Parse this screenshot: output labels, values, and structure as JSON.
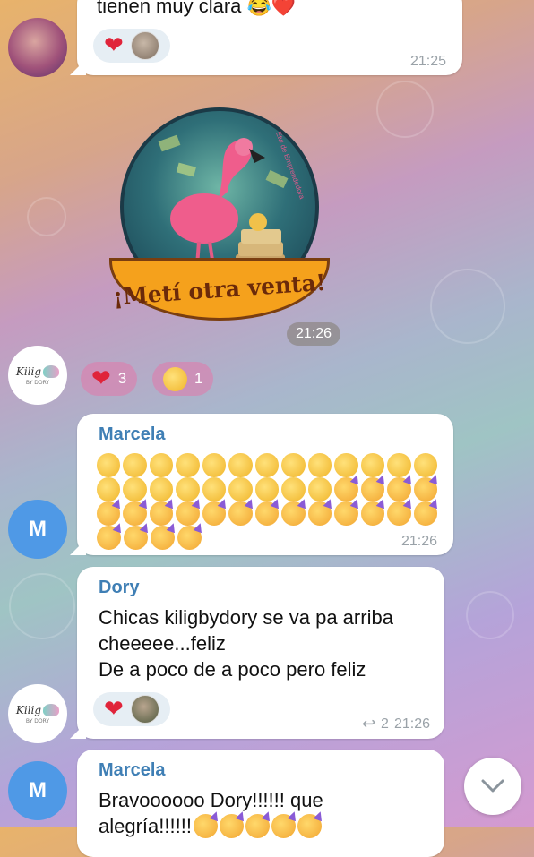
{
  "messages": {
    "m1": {
      "text": "tienen muy clara 😂❤️",
      "time": "21:25",
      "reaction_heart": "❤"
    },
    "sticker": {
      "caption": "¡Metí otra venta!",
      "small_text": "Etw de Emprendedora",
      "time": "21:26"
    },
    "reactions_row": {
      "heart_count": "3",
      "clap_count": "1"
    },
    "m2": {
      "sender": "Marcela",
      "time": "21:26",
      "clap_count": 22,
      "party_count": 21
    },
    "m3": {
      "sender": "Dory",
      "text_line1": "Chicas kiligbydory se va pa arriba",
      "text_line2": "cheeeee...feliz",
      "text_line3": "De a poco de a poco pero feliz",
      "reply_count": "2",
      "time": "21:26"
    },
    "m4": {
      "sender": "Marcela",
      "text_line1": "Bravoooooo Dory!!!!!! que",
      "text_line2": "alegría!!!!!!"
    }
  },
  "avatars": {
    "marcela_letter": "M",
    "logo_name": "Kilig",
    "logo_sub": "BY DORY"
  },
  "icons": {
    "heart": "heart-icon",
    "clap": "clap-icon",
    "reply": "reply-arrow-icon",
    "scroll_down": "chevron-down-icon"
  },
  "colors": {
    "sender_name": "#3f7fb5",
    "avatar_blue": "#4f99e6",
    "heart_red": "#e0243a"
  }
}
